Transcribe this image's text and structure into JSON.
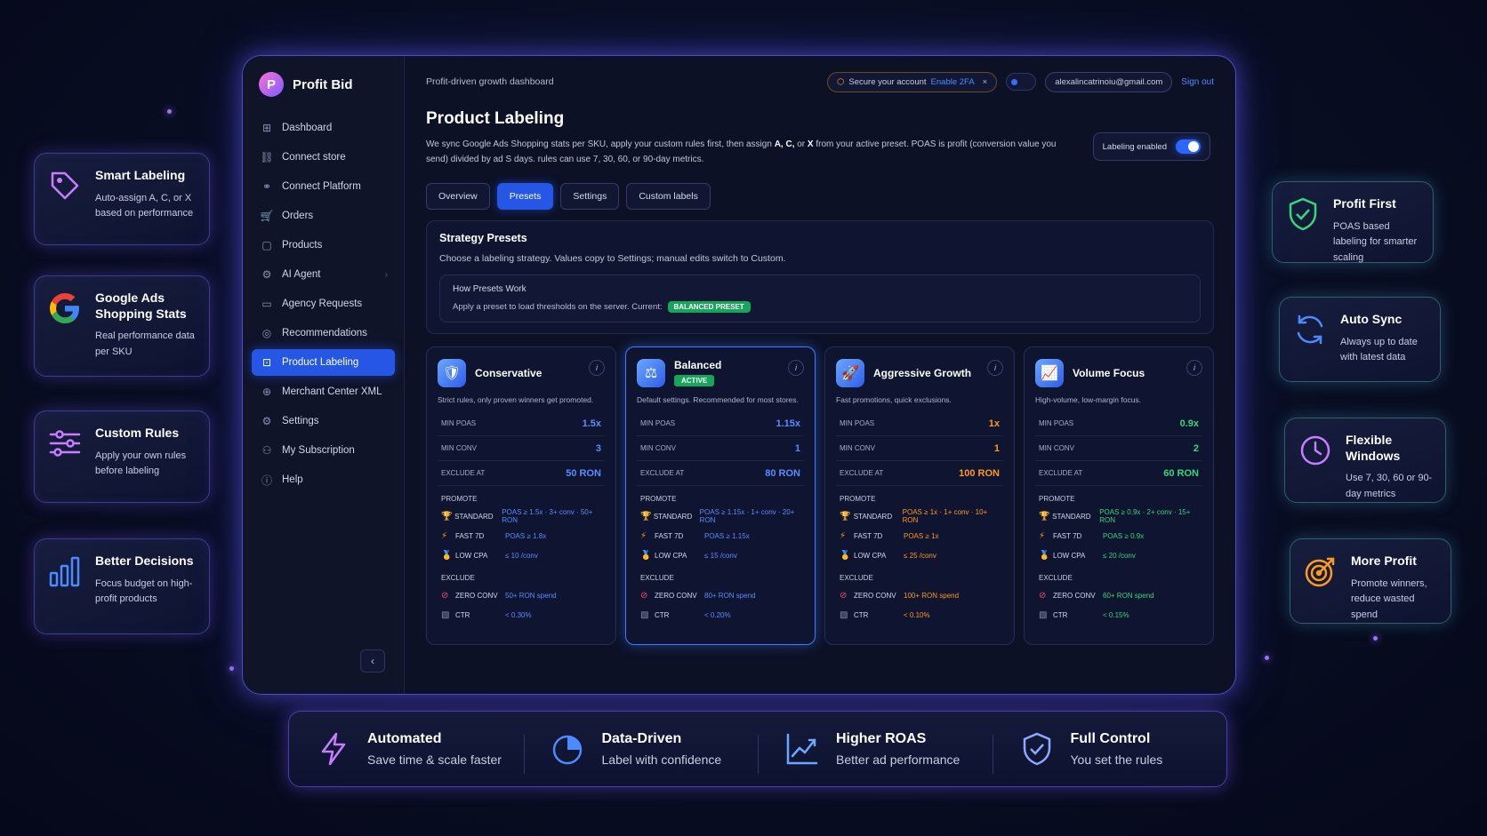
{
  "left_features": [
    {
      "title": "Smart Labeling",
      "desc": "Auto-assign A, C, or X based on performance",
      "icon": "tag-icon"
    },
    {
      "title": "Google Ads Shopping Stats",
      "desc": "Real performance data per SKU",
      "icon": "google-icon"
    },
    {
      "title": "Custom Rules",
      "desc": "Apply your own rules before labeling",
      "icon": "sliders-icon"
    },
    {
      "title": "Better Decisions",
      "desc": "Focus budget on high-profit products",
      "icon": "bar-chart-icon"
    }
  ],
  "right_features": [
    {
      "title": "Profit First",
      "desc": "POAS based labeling for smarter scaling",
      "icon": "shield-check-icon"
    },
    {
      "title": "Auto Sync",
      "desc": "Always up to date with latest data",
      "icon": "sync-icon"
    },
    {
      "title": "Flexible Windows",
      "desc": "Use 7, 30, 60 or 90-day metrics",
      "icon": "clock-icon"
    },
    {
      "title": "More Profit",
      "desc": "Promote winners, reduce wasted spend",
      "icon": "target-icon"
    }
  ],
  "brand": {
    "name": "Profit Bid",
    "logo": "P"
  },
  "nav": [
    {
      "label": "Dashboard",
      "icon": "⊞"
    },
    {
      "label": "Connect store",
      "icon": "⛓"
    },
    {
      "label": "Connect Platform",
      "icon": "⚭"
    },
    {
      "label": "Orders",
      "icon": "🛒"
    },
    {
      "label": "Products",
      "icon": "▢"
    },
    {
      "label": "AI Agent",
      "icon": "⚙"
    },
    {
      "label": "Agency Requests",
      "icon": "▭"
    },
    {
      "label": "Recommendations",
      "icon": "◎"
    },
    {
      "label": "Product Labeling",
      "icon": "⊡"
    },
    {
      "label": "Merchant Center XML",
      "icon": "⊕"
    },
    {
      "label": "Settings",
      "icon": "⚙"
    },
    {
      "label": "My Subscription",
      "icon": "⚇"
    },
    {
      "label": "Help",
      "icon": "ⓘ"
    }
  ],
  "topbar": {
    "subtitle": "Profit-driven growth dashboard",
    "security_text": "Secure your account",
    "security_link": "Enable 2FA",
    "email": "alexalincatrinoiu@gmail.com",
    "signout": "Sign out"
  },
  "page": {
    "title": "Product Labeling",
    "desc_1": "We sync Google Ads Shopping stats per SKU, apply your custom rules first, then assign ",
    "desc_bold": "A, C,",
    "desc_2": " or ",
    "desc_bold2": "X",
    "desc_3": " from your active preset. POAS is profit (conversion value you send) divided by ad S days. rules can use 7, 30, 60, or 90-day metrics.",
    "toggle_label": "Labeling enabled"
  },
  "tabs": [
    "Overview",
    "Presets",
    "Settings",
    "Custom labels"
  ],
  "strategy": {
    "title": "Strategy Presets",
    "desc": "Choose a labeling strategy. Values copy to Settings; manual edits switch to Custom.",
    "how_title": "How Presets Work",
    "how_desc": "Apply a preset to load thresholds on the server. Current:",
    "current_badge": "BALANCED PRESET"
  },
  "labels": {
    "min_poas": "MIN POAS",
    "min_conv": "MIN CONV",
    "exclude_at": "EXCLUDE AT",
    "promote": "PROMOTE",
    "exclude": "EXCLUDE",
    "standard": "STANDARD",
    "fast7d": "FAST 7D",
    "low_cpa": "LOW CPA",
    "zero_conv": "ZERO CONV",
    "ctr": "CTR",
    "active": "ACTIVE"
  },
  "presets": [
    {
      "name": "Conservative",
      "desc": "Strict rules, only proven winners get promoted.",
      "color": "blue",
      "icon": "🛡",
      "min_poas": "1.5x",
      "min_conv": "3",
      "exclude_at": "50 RON",
      "standard": "POAS ≥ 1.5x · 3+ conv · 50+ RON",
      "fast7d": "POAS ≥ 1.8x",
      "low_cpa": "≤ 10 /conv",
      "zero_conv": "50+ RON spend",
      "ctr": "< 0.30%"
    },
    {
      "name": "Balanced",
      "desc": "Default settings. Recommended for most stores.",
      "color": "blue",
      "icon": "⚖",
      "min_poas": "1.15x",
      "min_conv": "1",
      "exclude_at": "80 RON",
      "standard": "POAS ≥ 1.15x · 1+ conv · 20+ RON",
      "fast7d": "POAS ≥ 1.15x",
      "low_cpa": "≤ 15 /conv",
      "zero_conv": "80+ RON spend",
      "ctr": "< 0.20%"
    },
    {
      "name": "Aggressive Growth",
      "desc": "Fast promotions, quick exclusions.",
      "color": "orange",
      "icon": "🚀",
      "min_poas": "1x",
      "min_conv": "1",
      "exclude_at": "100 RON",
      "standard": "POAS ≥ 1x · 1+ conv · 10+ RON",
      "fast7d": "POAS ≥ 1x",
      "low_cpa": "≤ 25 /conv",
      "zero_conv": "100+ RON spend",
      "ctr": "< 0.10%"
    },
    {
      "name": "Volume Focus",
      "desc": "High-volume, low-margin focus.",
      "color": "green",
      "icon": "📈",
      "min_poas": "0.9x",
      "min_conv": "2",
      "exclude_at": "60 RON",
      "standard": "POAS ≥ 0.9x · 2+ conv · 15+ RON",
      "fast7d": "POAS ≥ 0.9x",
      "low_cpa": "≤ 20 /conv",
      "zero_conv": "60+ RON spend",
      "ctr": "< 0.15%"
    }
  ],
  "bottom": [
    {
      "title": "Automated",
      "sub": "Save time & scale faster",
      "icon": "lightning-icon"
    },
    {
      "title": "Data-Driven",
      "sub": "Label with confidence",
      "icon": "pie-chart-icon"
    },
    {
      "title": "Higher ROAS",
      "sub": "Better ad performance",
      "icon": "growth-chart-icon"
    },
    {
      "title": "Full Control",
      "sub": "You set the rules",
      "icon": "shield-icon"
    }
  ],
  "colors": {
    "accent": "#2556e6",
    "success": "#17a55a",
    "orange": "#ff9a1f",
    "green": "#36d67a",
    "purple": "#a070ff"
  }
}
